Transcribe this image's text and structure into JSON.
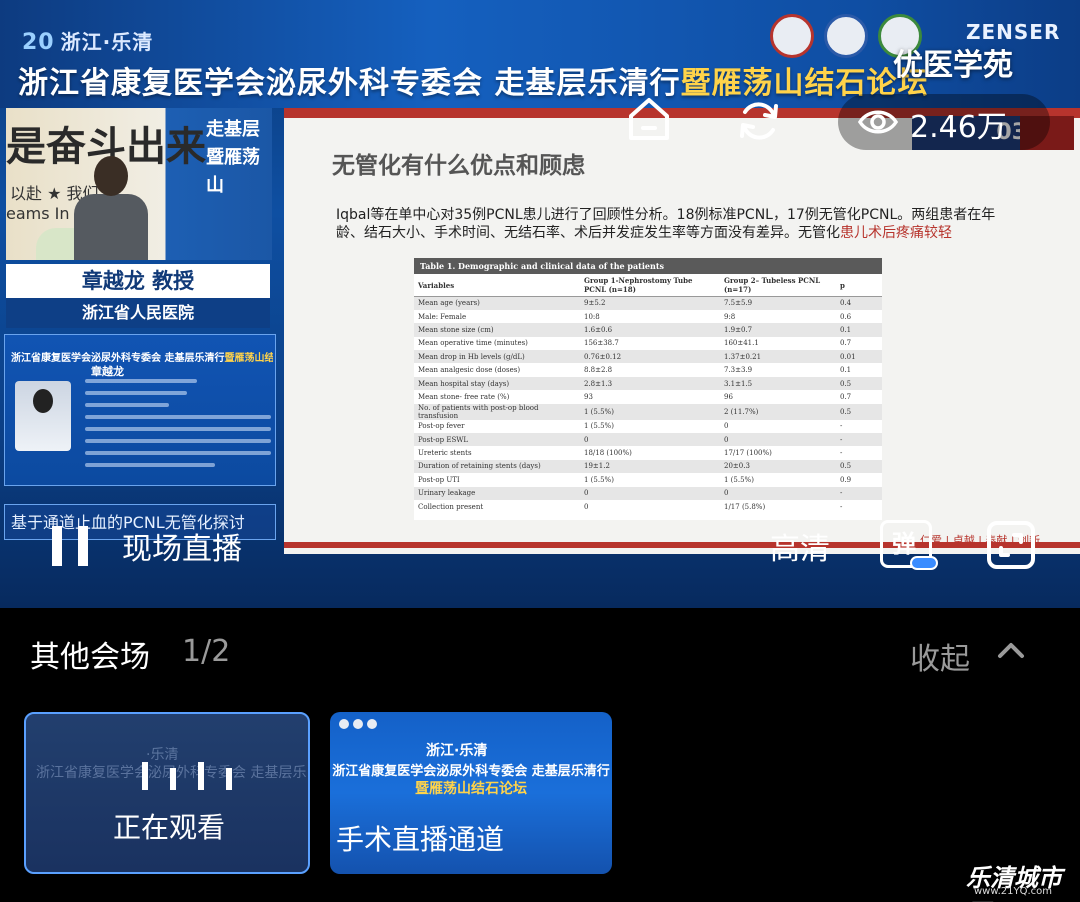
{
  "stream": {
    "brand": "优医学苑",
    "view_count": "2.46万",
    "live_label": "现场直播",
    "quality_label": "高清",
    "danmu_label": "弹"
  },
  "banner": {
    "region_prefix": "浙江",
    "region_name": "·乐清",
    "title_main": "浙江省康复医学会泌尿外科专委会 走基层乐清行",
    "title_accent": "暨雁荡山结石论坛",
    "sponsor": "ZENSER"
  },
  "speaker": {
    "name": "章越龙 教授",
    "hospital": "浙江省人民医院",
    "calligraphy_1": "是奋斗出来",
    "calligraphy_2": "以赴 ★ 我们",
    "calligraphy_3": "eams In",
    "right_text": "走基层暨雁荡山"
  },
  "profile_card": {
    "title_main": "浙江省康复医学会泌尿外科专委会 走基层乐清行",
    "title_accent": "暨雁荡山结石论坛",
    "name": "章越龙"
  },
  "topic": "基于通道止血的PCNL无管化探讨",
  "slide": {
    "title": "无管化有什么优点和顾虑",
    "corner_text": "03.12",
    "body_part1": "Iqbal等在单中心对35例PCNL患儿进行了回顾性分析。18例标准PCNL，17例无管化PCNL。两组患者在年龄、结石大小、手术时间、无结石率、术后并发症发生率等方面没有差异。无管化",
    "body_red": "患儿术后疼痛较轻",
    "footer": "仁爱 | 卓越 | 奉献 | 创新",
    "table": {
      "caption": "Table 1. Demographic and clinical data of the patients",
      "headers": [
        "Variables",
        "Group 1-Nephrostomy Tube PCNL (n=18)",
        "Group 2– Tubeless PCNL (n=17)",
        "p"
      ],
      "rows": [
        [
          "Mean age (years)",
          "9±5.2",
          "7.5±5.9",
          "0.4"
        ],
        [
          "Male: Female",
          "10:8",
          "9:8",
          "0.6"
        ],
        [
          "Mean stone size (cm)",
          "1.6±0.6",
          "1.9±0.7",
          "0.1"
        ],
        [
          "Mean operative time (minutes)",
          "156±38.7",
          "160±41.1",
          "0.7"
        ],
        [
          "Mean drop in Hb levels (g/dL)",
          "0.76±0.12",
          "1.37±0.21",
          "0.01"
        ],
        [
          "Mean analgesic dose (doses)",
          "8.8±2.8",
          "7.3±3.9",
          "0.1"
        ],
        [
          "Mean hospital stay (days)",
          "2.8±1.3",
          "3.1±1.5",
          "0.5"
        ],
        [
          "Mean stone- free rate (%)",
          "93",
          "96",
          "0.7"
        ],
        [
          "No. of patients with post-op blood transfusion",
          "1 (5.5%)",
          "2 (11.7%)",
          "0.5"
        ],
        [
          "Post-op fever",
          "1 (5.5%)",
          "0",
          "-"
        ],
        [
          "Post-op ESWL",
          "0",
          "0",
          "-"
        ],
        [
          "Ureteric stents",
          "18/18 (100%)",
          "17/17 (100%)",
          "-"
        ],
        [
          "Duration of retaining stents (days)",
          "19±1.2",
          "20±0.3",
          "0.5"
        ],
        [
          "Post-op UTI",
          "1 (5.5%)",
          "1 (5.5%)",
          "0.9"
        ],
        [
          "Urinary leakage",
          "0",
          "0",
          "-"
        ],
        [
          "Collection present",
          "0",
          "1/17 (5.8%)",
          "-"
        ]
      ]
    }
  },
  "other_venues": {
    "title": "其他会场",
    "page": "1/2",
    "collapse_label": "收起",
    "venues": [
      {
        "label": "正在观看",
        "status": "current"
      },
      {
        "label": "手术直播通道",
        "region": "浙江·乐清",
        "title": "浙江省康复医学会泌尿外科专委会 走基层乐清行",
        "subtitle": "暨雁荡山结石论坛"
      }
    ]
  },
  "watermark": {
    "name": "乐清城市网",
    "url": "www.21YQ.com"
  },
  "colors": {
    "slide_red": "#b7342d",
    "accent_yellow": "#ffd34a",
    "toggle_blue": "#3a8cff",
    "card_border": "#5aa0ff"
  }
}
